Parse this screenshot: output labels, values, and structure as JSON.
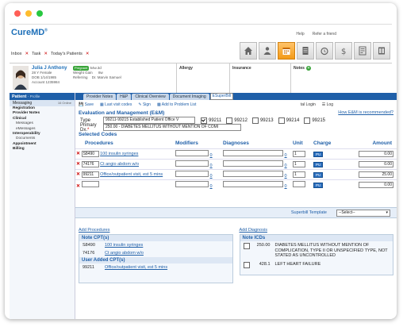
{
  "brand": {
    "name_main": "Cure",
    "name_accent": "MD",
    "tm": "®"
  },
  "top_links": [
    "Help",
    "Refer a friend"
  ],
  "inbox": {
    "inbox": "Inbox",
    "task": "Task",
    "todays_patients": "Today's Patients"
  },
  "patient": {
    "name": "Julia J Anthony",
    "age_sex": "28 Y Female",
    "dob": "DOB 1/14/1985",
    "account": "Account 1235984",
    "status": "Pregnant",
    "weight": "54w.3d",
    "weight_gain_label": "Weight Gain",
    "weight_gain": "8w",
    "referring_label": "Referring",
    "referring": "Dr. Marvin Samuel",
    "allergy_label": "Allergy",
    "insurance_label": "Insurance",
    "notes_label": "Notes"
  },
  "sidebar": {
    "title": "Patient",
    "title_sub": "- Profile",
    "messaging": "Messaging",
    "online": "16 Online",
    "items": [
      {
        "label": "Registration",
        "sub": false
      },
      {
        "label": "Provider Notes",
        "sub": false
      },
      {
        "label": "Clinical",
        "sub": false
      },
      {
        "label": "Messages",
        "sub": true
      },
      {
        "label": "eMessages",
        "sub": true
      },
      {
        "label": "Interoperability",
        "sub": false
      },
      {
        "label": "Documents",
        "sub": true
      },
      {
        "label": "Appointment",
        "sub": false
      },
      {
        "label": "Billing",
        "sub": false
      }
    ]
  },
  "tabs": [
    "Provider Notes",
    "H&P",
    "Clinical Overview",
    "Document Imaging",
    "ESuperBill"
  ],
  "actions": {
    "save": "Save",
    "last_visit": "Last visit codes",
    "sign": "Sign",
    "add_problem": "Add to Problem List",
    "login": "tal Login",
    "log": "Log"
  },
  "em": {
    "title": "Evaluation and Management (E&M)",
    "recommended_link": "How E&M is recommended?",
    "type_label": "Type",
    "type_value": "99211-99215 Established Patient Office V",
    "codes": [
      {
        "code": "99211",
        "checked": true
      },
      {
        "code": "99212",
        "checked": false
      },
      {
        "code": "99213",
        "checked": false
      },
      {
        "code": "99214",
        "checked": false
      },
      {
        "code": "99215",
        "checked": false
      }
    ],
    "primary_dx_label": "Primary Dx.",
    "primary_dx_value": "250.00 - DIABETES MELLITUS WITHOUT MENTION OF COMI"
  },
  "selected_codes": {
    "title": "Selected Codes",
    "headers": {
      "procedures": "Procedures",
      "modifiers": "Modifiers",
      "diagnoses": "Diagnoses",
      "unit": "Unit",
      "charge": "Charge",
      "amount": "Amount"
    },
    "rows": [
      {
        "code": "S8490",
        "desc": "100 insulin syringes",
        "mod_count": "0",
        "diag_count": "0",
        "unit": "1",
        "charge": "PU",
        "amount": "0.00"
      },
      {
        "code": "74176",
        "desc": "Ct angio abdom w/o",
        "mod_count": "0",
        "diag_count": "0",
        "unit": "1",
        "charge": "PU",
        "amount": "0.00"
      },
      {
        "code": "99211",
        "desc": "Office/outpatient visit, est 5 mins",
        "mod_count": "0",
        "diag_count": "0",
        "unit": "1",
        "charge": "PU",
        "amount": "25.00"
      },
      {
        "code": "",
        "desc": "",
        "mod_count": "0",
        "diag_count": "0",
        "unit": "",
        "charge": "PU",
        "amount": "0.00"
      }
    ]
  },
  "superbill": {
    "label": "Superbill Template",
    "value": "--Select--"
  },
  "add_procedures": "Add Procedures",
  "add_diagnosis": "Add Diagnosis",
  "note_cpts": {
    "title": "Note CPT(s)",
    "items": [
      {
        "code": "S8490",
        "desc": "100 insulin syringes"
      },
      {
        "code": "74176",
        "desc": "Ct angio abdom w/o"
      }
    ],
    "user_title": "User Added CPT(s)",
    "user_items": [
      {
        "code": "99211",
        "desc": "Office/outpatient visit, est 5 mins"
      }
    ]
  },
  "note_icds": {
    "title": "Note ICDs",
    "items": [
      {
        "code": "250.00",
        "desc": "DIABETES MELLITUS WITHOUT MENTION OF COMPLICATION, TYPE II OR UNSPECIFIED TYPE, NOT STATED AS UNCONTROLLED"
      },
      {
        "code": "428.1",
        "desc": "LEFT HEART FAILURE"
      }
    ]
  },
  "colors": {
    "brand_blue": "#1f5fa8",
    "accent_orange": "#f39a17",
    "close_red": "#ff5f57",
    "min_yellow": "#febc2e",
    "max_green": "#28c840"
  }
}
